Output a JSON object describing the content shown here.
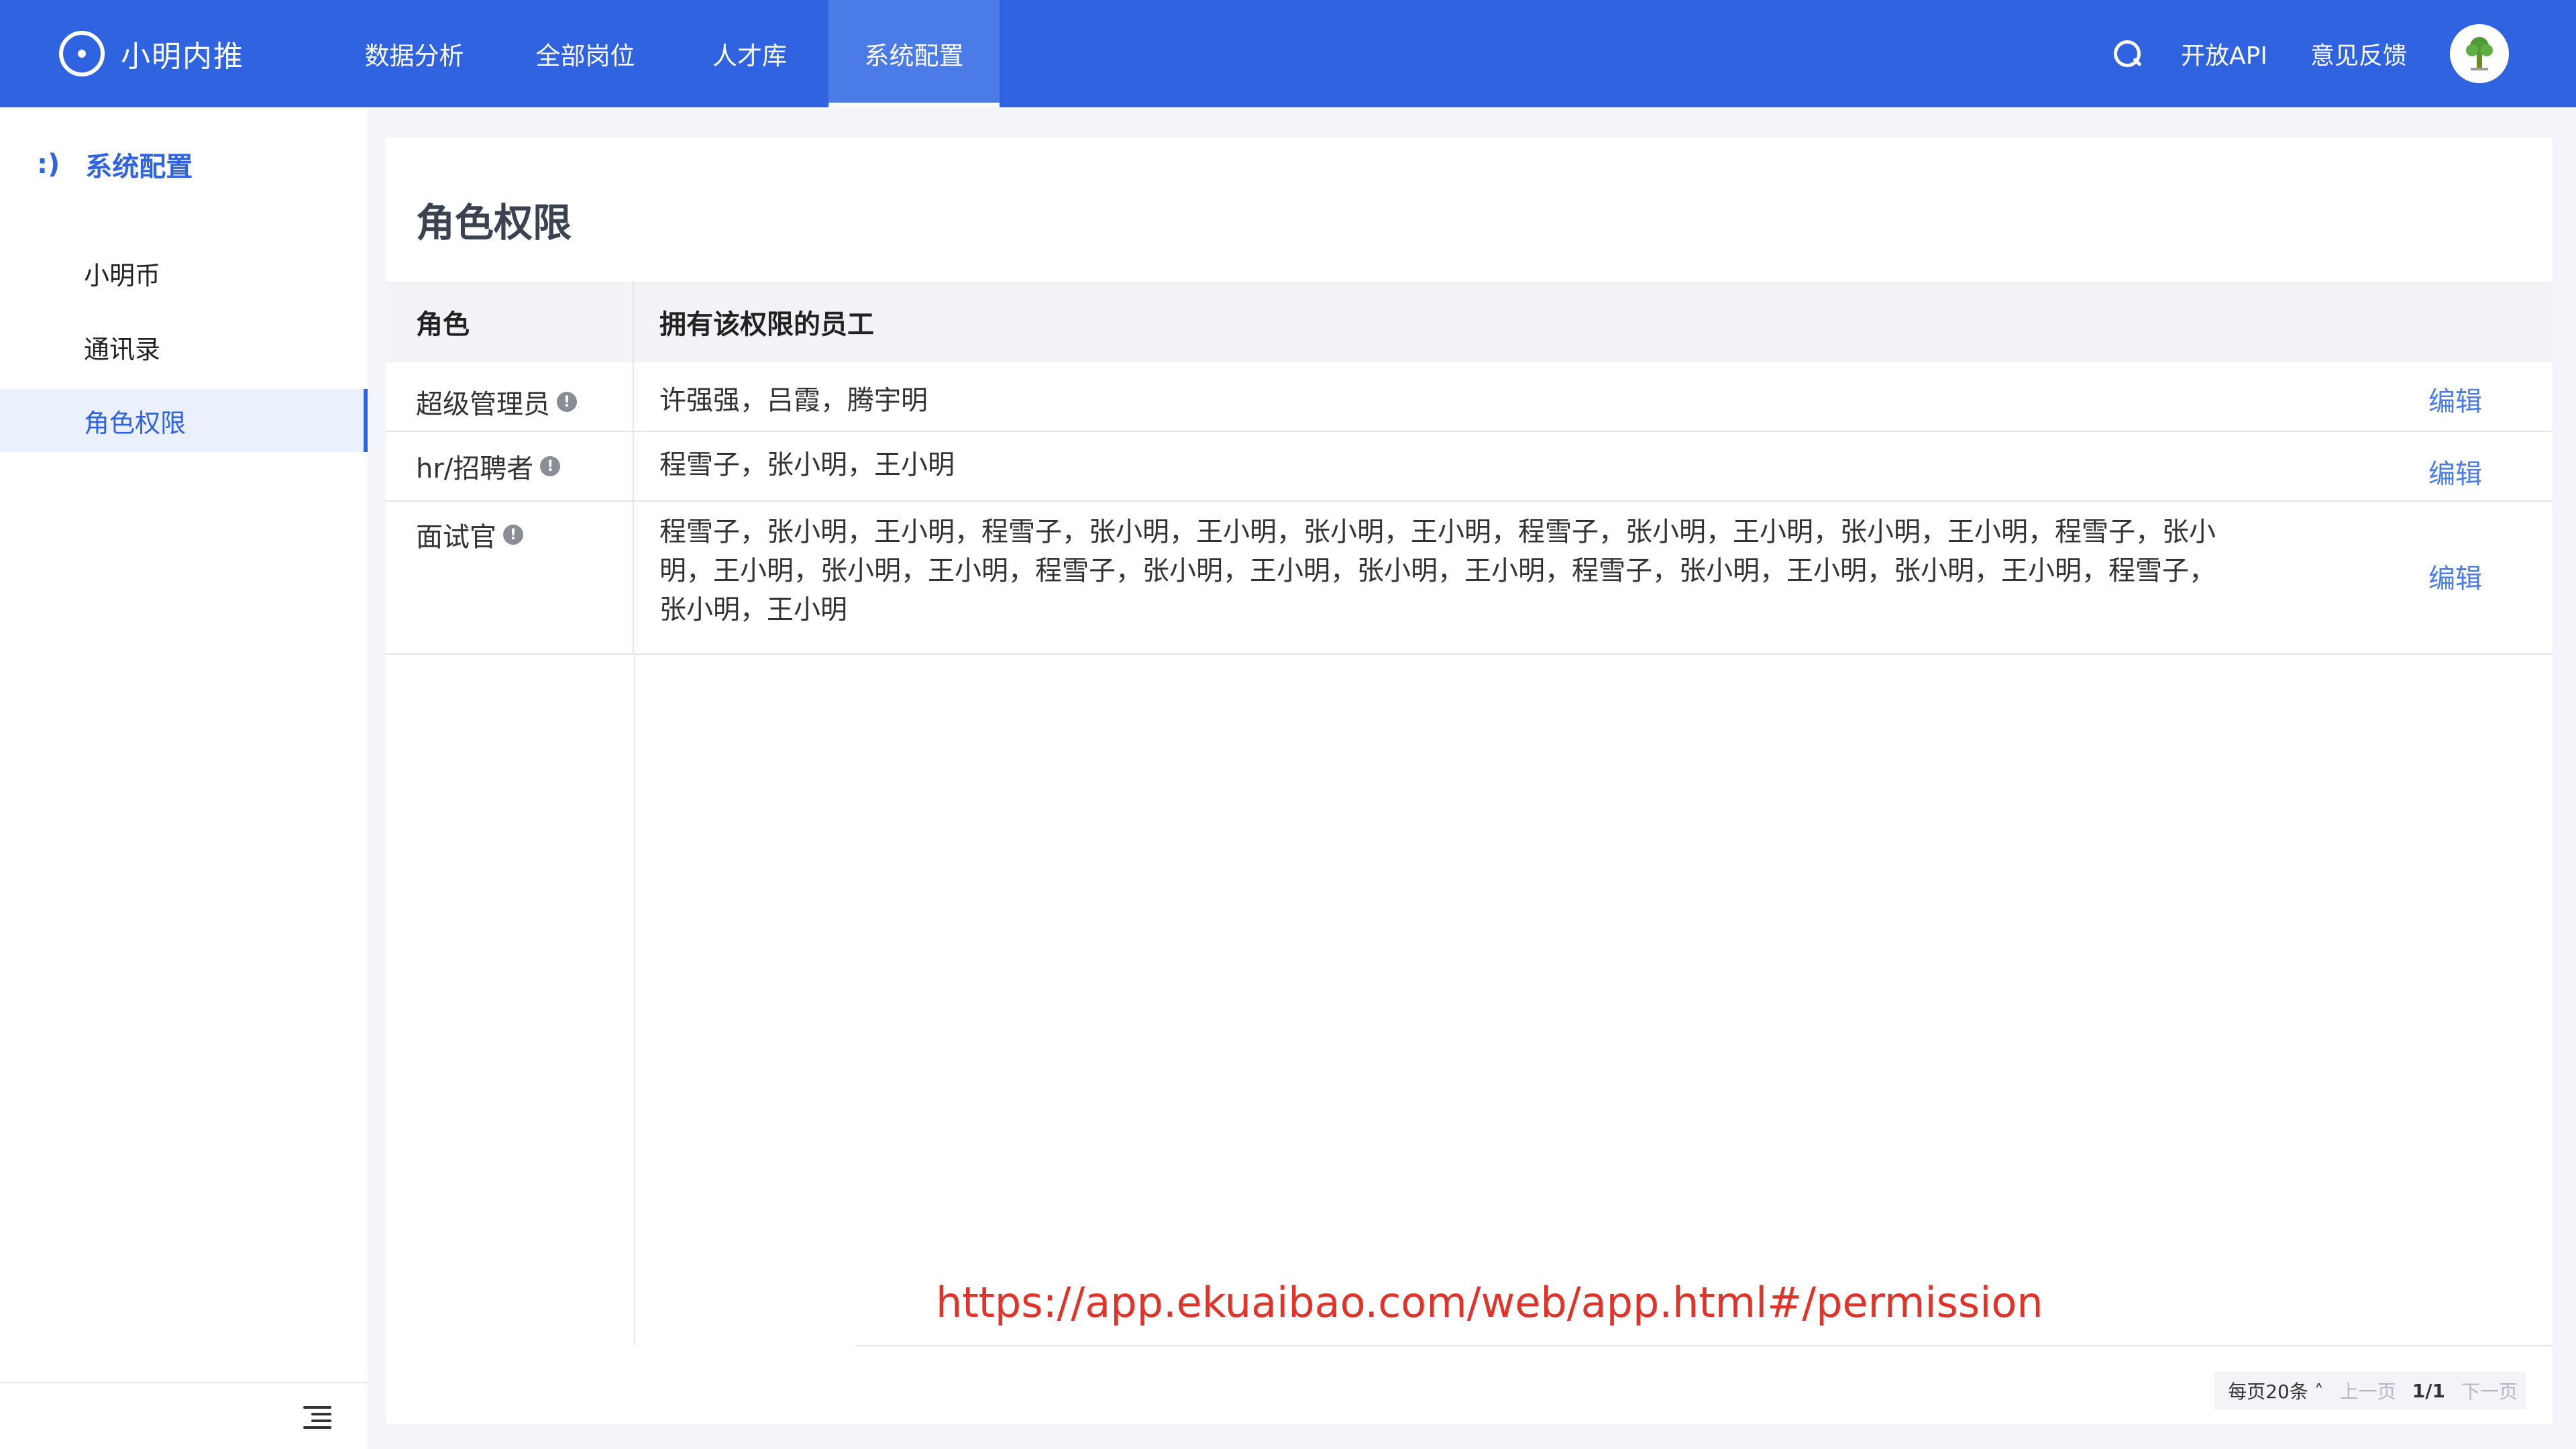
{
  "app": {
    "name": "小明内推"
  },
  "nav": {
    "items": [
      {
        "label": "数据分析"
      },
      {
        "label": "全部岗位"
      },
      {
        "label": "人才库"
      },
      {
        "label": "系统配置"
      }
    ],
    "active_index": 3
  },
  "top_right": {
    "search_icon": "search-icon",
    "api_label": "开放API",
    "feedback_label": "意见反馈"
  },
  "sidebar": {
    "header_glyph": ":)",
    "header_label": "系统配置",
    "items": [
      {
        "label": "小明币"
      },
      {
        "label": "通讯录"
      },
      {
        "label": "角色权限"
      }
    ],
    "active_index": 2
  },
  "page": {
    "title": "角色权限"
  },
  "table": {
    "columns": [
      "角色",
      "拥有该权限的员工"
    ],
    "rows": [
      {
        "role": "超级管理员",
        "staff": "许强强，吕霞，腾宇明",
        "action": "编辑"
      },
      {
        "role": "hr/招聘者",
        "staff": "程雪子，张小明，王小明",
        "action": "编辑"
      },
      {
        "role": "面试官",
        "staff": "程雪子，张小明，王小明，程雪子，张小明，王小明，张小明，王小明，程雪子，张小明，王小明，张小明，王小明，程雪子，张小明，王小明，张小明，王小明，程雪子，张小明，王小明，张小明，王小明，程雪子，张小明，王小明，张小明，王小明，程雪子，张小明，王小明",
        "action": "编辑"
      }
    ]
  },
  "url_note": "https://app.ekuaibao.com/web/app.html#/permission",
  "pager": {
    "per_page": "每页20条",
    "prev": "上一页",
    "page": "1/1",
    "next": "下一页"
  },
  "colors": {
    "topbar": "#2f63df",
    "accent": "#2f63df",
    "link": "#4a7be6",
    "url_note": "#e0332a"
  }
}
